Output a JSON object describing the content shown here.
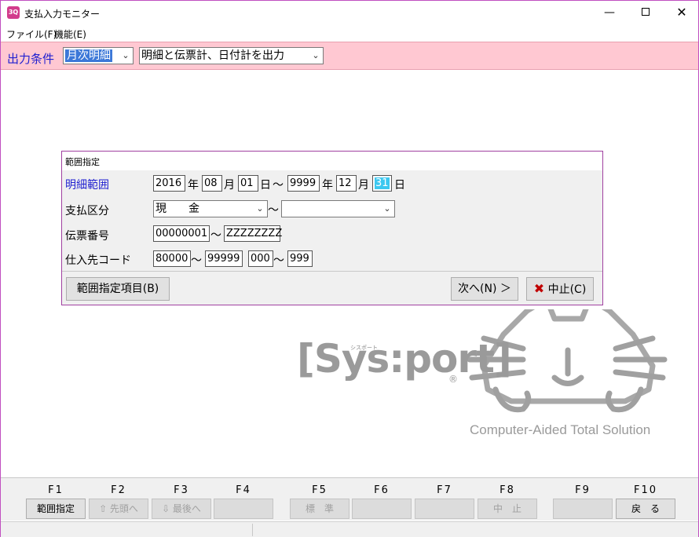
{
  "window": {
    "icon_text": "3Q",
    "title": "支払入力モニター",
    "minimize_symbol": "—",
    "close_symbol": "✕"
  },
  "menu": {
    "file": "ファイル(F)",
    "function": "機能(E)"
  },
  "condition": {
    "label": "出力条件",
    "period_value": "月次明細",
    "output_value": "明細と伝票計、日付計を出力"
  },
  "dialog": {
    "caption": "範囲指定",
    "date_range": {
      "label": "明細範囲",
      "from_year": "2016",
      "from_month": "08",
      "from_day": "01",
      "to_year": "9999",
      "to_month": "12",
      "to_day": "31",
      "year_unit": "年",
      "month_unit": "月",
      "day_unit": "日",
      "tilde": "～"
    },
    "payment_type": {
      "label": "支払区分",
      "from_value": "現　　金",
      "to_value": "",
      "tilde": "～"
    },
    "slip_number": {
      "label": "伝票番号",
      "from_value": "00000001",
      "to_value": "ZZZZZZZZ",
      "tilde": "～"
    },
    "supplier_code": {
      "label": "仕入先コード",
      "from_main": "80000",
      "to_main": "99999",
      "from_sub": "000",
      "to_sub": "999",
      "tilde": "～"
    },
    "buttons": {
      "range_items": "範囲指定項目(B)",
      "next": "次へ(N) ＞",
      "cancel": "中止(C)",
      "cancel_icon": "✖"
    }
  },
  "logo": {
    "brand": "[Sys:port]",
    "kana": "シスポート",
    "registered": "®",
    "tagline": "Computer-Aided Total Solution"
  },
  "function_keys": [
    {
      "key": "F1",
      "label": "範囲指定",
      "enabled": true
    },
    {
      "key": "F2",
      "label": "⇧ 先頭へ",
      "enabled": false
    },
    {
      "key": "F3",
      "label": "⇩ 最後へ",
      "enabled": false
    },
    {
      "key": "F4",
      "label": "",
      "enabled": false
    },
    {
      "key": "F5",
      "label": "標　準",
      "enabled": false
    },
    {
      "key": "F6",
      "label": "",
      "enabled": false
    },
    {
      "key": "F7",
      "label": "",
      "enabled": false
    },
    {
      "key": "F8",
      "label": "中　止",
      "enabled": false
    },
    {
      "key": "F9",
      "label": "",
      "enabled": false
    },
    {
      "key": "F10",
      "label": "戻　る",
      "enabled": true
    }
  ]
}
